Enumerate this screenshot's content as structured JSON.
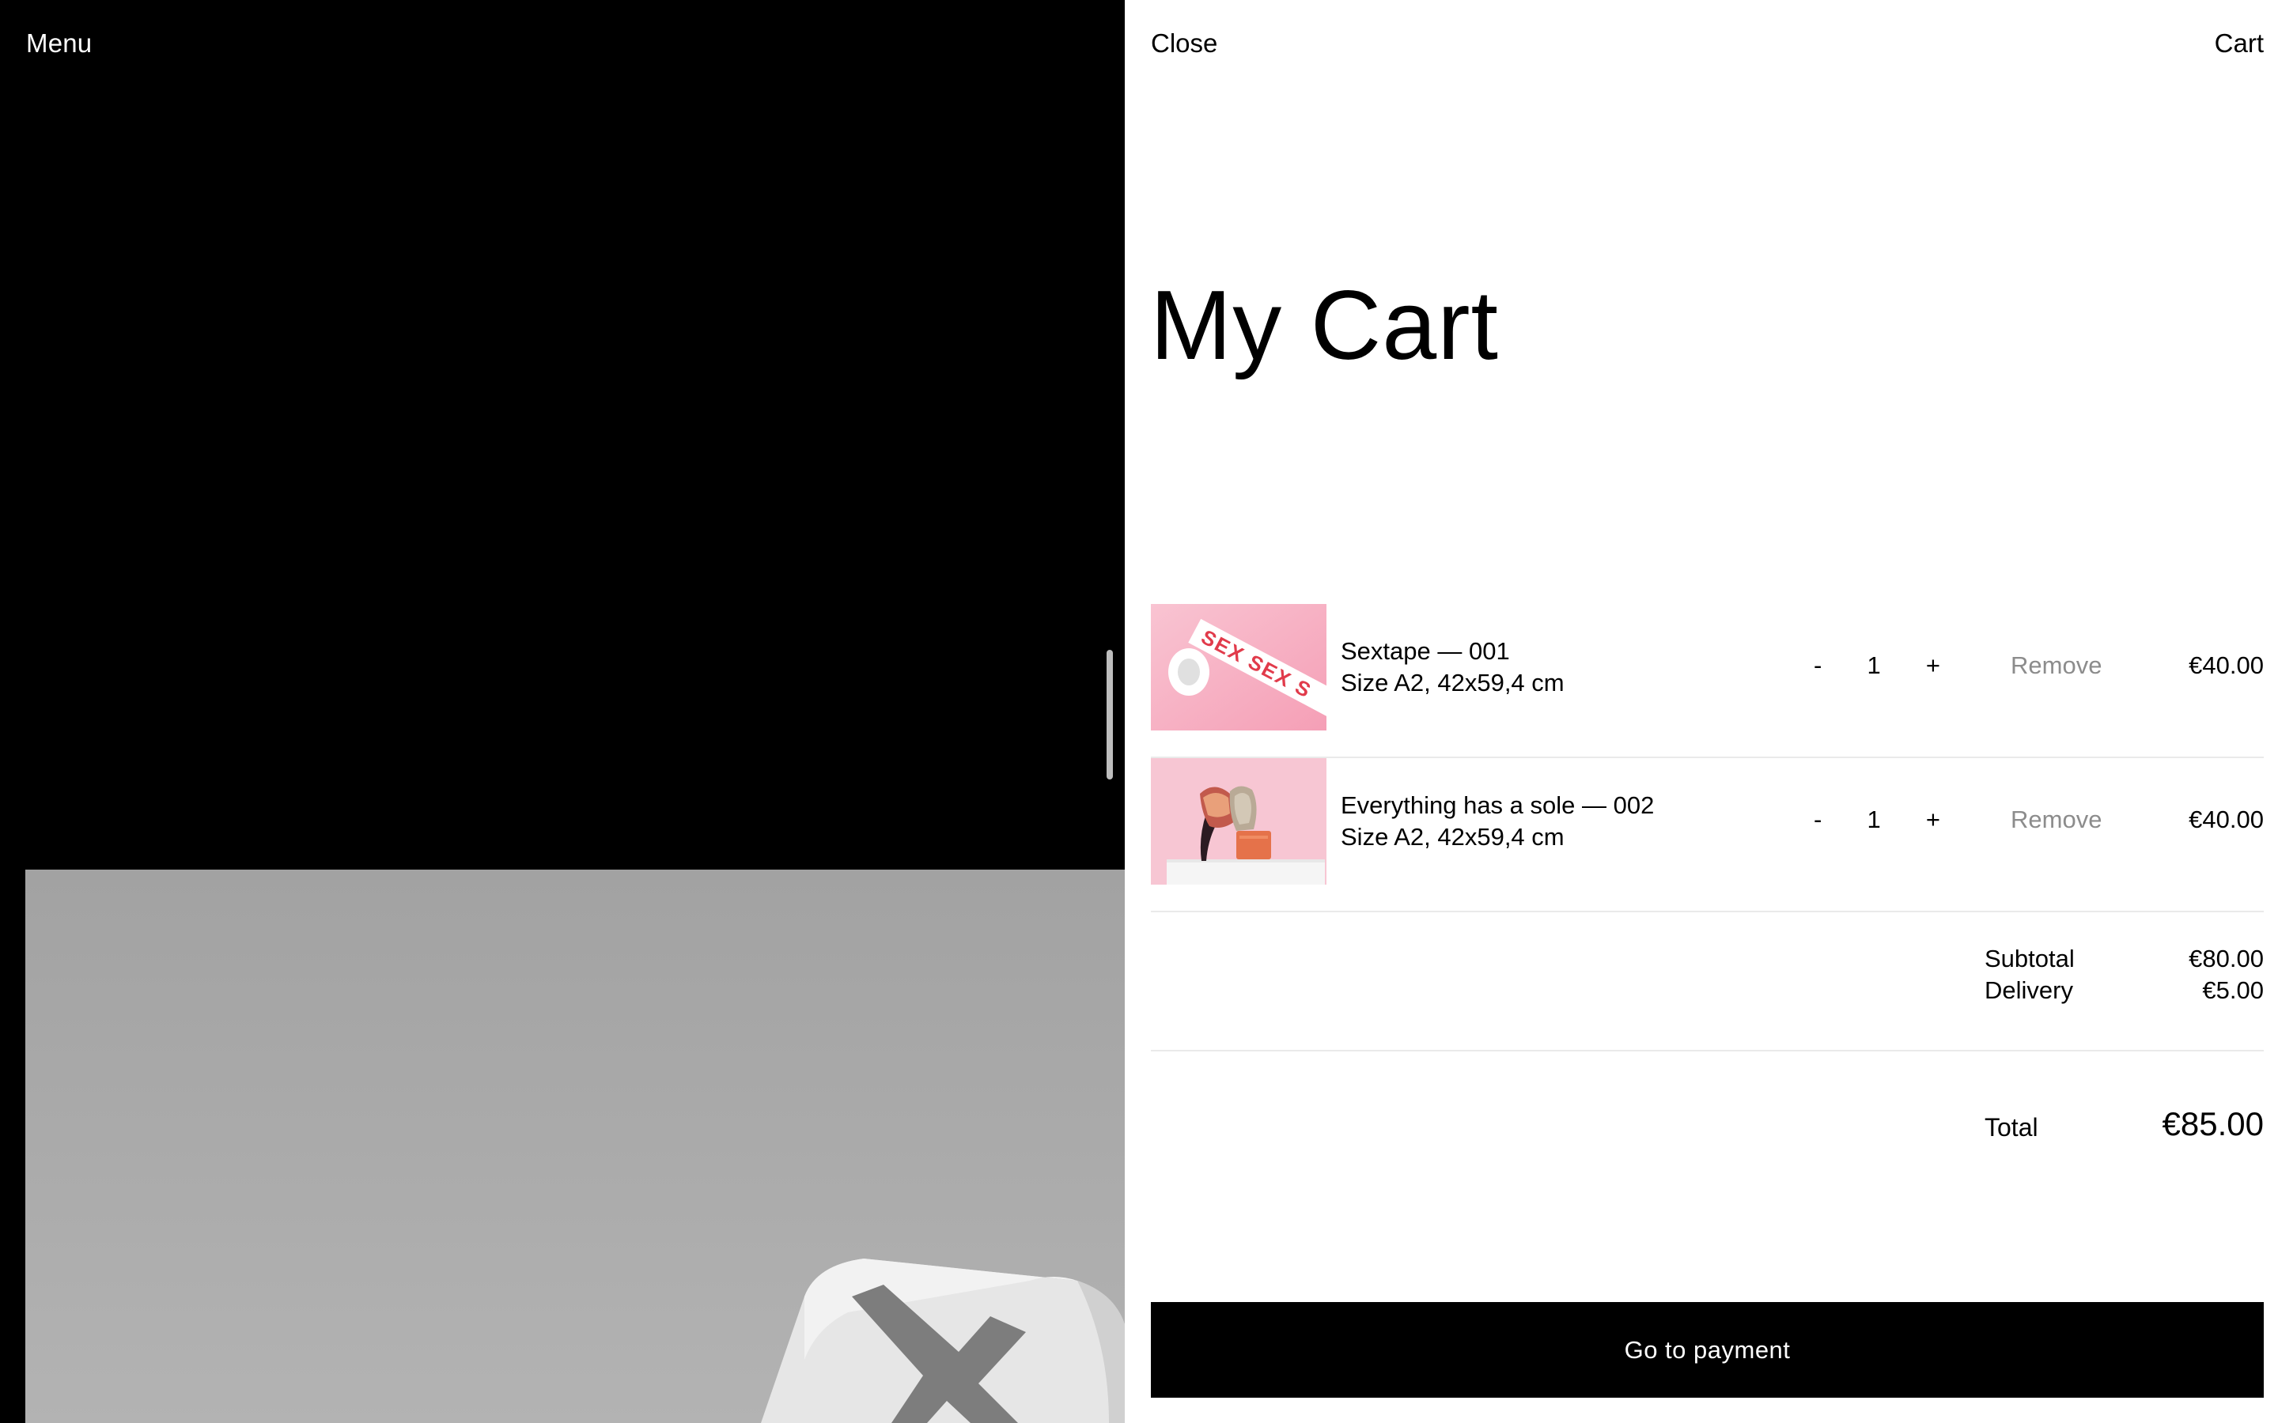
{
  "header": {
    "menu_label": "Menu",
    "close_label": "Close",
    "cart_label": "Cart"
  },
  "cart": {
    "title": "My Cart",
    "items": [
      {
        "name": "Sextape — 001",
        "size": "Size A2, 42x59,4 cm",
        "qty_minus": "-",
        "quantity": "1",
        "qty_plus": "+",
        "remove_label": "Remove",
        "price": "€40.00",
        "image_text": "SEX SEX S"
      },
      {
        "name": "Everything has a sole — 002",
        "size": "Size A2, 42x59,4 cm",
        "qty_minus": "-",
        "quantity": "1",
        "qty_plus": "+",
        "remove_label": "Remove",
        "price": "€40.00"
      }
    ],
    "subtotal_label": "Subtotal",
    "subtotal_value": "€80.00",
    "delivery_label": "Delivery",
    "delivery_value": "€5.00",
    "total_label": "Total",
    "total_value": "€85.00",
    "pay_button_label": "Go to payment"
  },
  "colors": {
    "background_left": "#000000",
    "drawer_background": "#ffffff",
    "muted_text": "#8c8c8c",
    "divider": "#eaeaea",
    "thumb_pink": "#f7b6c8"
  }
}
